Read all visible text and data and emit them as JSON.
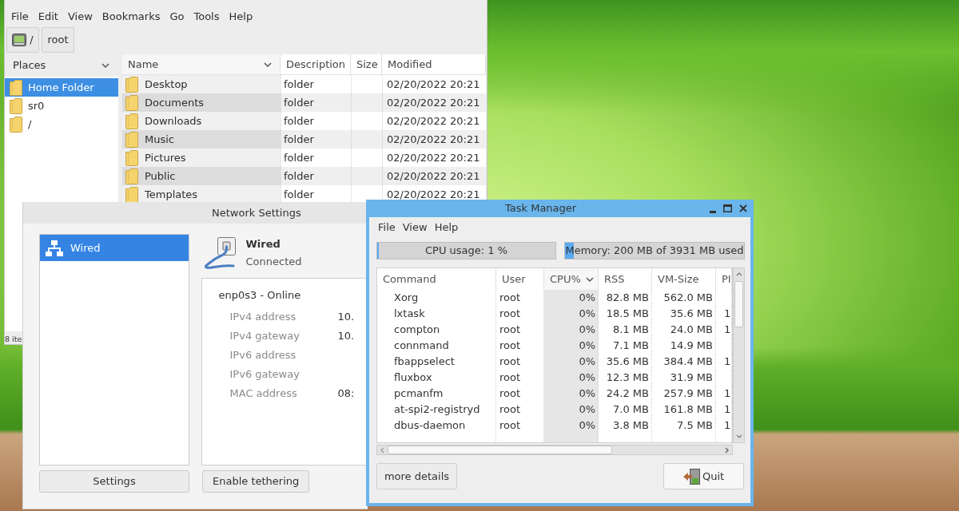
{
  "file_manager": {
    "menu": [
      "File",
      "Edit",
      "View",
      "Bookmarks",
      "Go",
      "Tools",
      "Help"
    ],
    "path_buttons": [
      {
        "label": "/",
        "kind": "drive"
      },
      {
        "label": "root",
        "kind": "plain"
      }
    ],
    "places": {
      "title": "Places",
      "items": [
        {
          "label": "Home Folder",
          "selected": true
        },
        {
          "label": "sr0",
          "selected": false
        },
        {
          "label": "/",
          "selected": false
        }
      ]
    },
    "columns": [
      {
        "label": "Name",
        "sorted": true
      },
      {
        "label": "Description",
        "sorted": false
      },
      {
        "label": "Size",
        "sorted": false
      },
      {
        "label": "Modified",
        "sorted": false
      }
    ],
    "rows": [
      {
        "name": "Desktop",
        "description": "folder",
        "modified": "02/20/2022 20:21"
      },
      {
        "name": "Documents",
        "description": "folder",
        "modified": "02/20/2022 20:21"
      },
      {
        "name": "Downloads",
        "description": "folder",
        "modified": "02/20/2022 20:21"
      },
      {
        "name": "Music",
        "description": "folder",
        "modified": "02/20/2022 20:21"
      },
      {
        "name": "Pictures",
        "description": "folder",
        "modified": "02/20/2022 20:21"
      },
      {
        "name": "Public",
        "description": "folder",
        "modified": "02/20/2022 20:21"
      },
      {
        "name": "Templates",
        "description": "folder",
        "modified": "02/20/2022 20:21"
      }
    ],
    "status_bar": "8 ite"
  },
  "network_settings": {
    "title": "Network Settings",
    "connections": [
      {
        "label": "Wired",
        "selected": true
      }
    ],
    "connection": {
      "name": "Wired",
      "status": "Connected"
    },
    "device": "enp0s3 - Online",
    "details": [
      {
        "label": "IPv4 address",
        "value": "10."
      },
      {
        "label": "IPv4 gateway",
        "value": "10."
      },
      {
        "label": "IPv6 address"
      },
      {
        "label": "IPv6 gateway"
      },
      {
        "label": "MAC address",
        "value": "08:"
      }
    ],
    "buttons": [
      "Settings",
      "Enable tethering"
    ]
  },
  "task_manager": {
    "title": "Task Manager",
    "menu": [
      "File",
      "View",
      "Help"
    ],
    "cpu": {
      "label": "CPU usage: 1 %",
      "level": 0.01
    },
    "memory": {
      "label": "Memory: 200 MB of 3931 MB used",
      "level": 0.05
    },
    "columns": [
      {
        "label": "Command",
        "sorted": false
      },
      {
        "label": "User",
        "sorted": false
      },
      {
        "label": "CPU%",
        "sorted": true
      },
      {
        "label": "RSS",
        "sorted": false
      },
      {
        "label": "VM-Size",
        "sorted": false
      },
      {
        "label": "PI",
        "sorted": false
      }
    ],
    "rows": [
      {
        "command": "Xorg",
        "user": "root",
        "cpu": "0%",
        "rss": "82.8 MB",
        "vm_size": "562.0 MB"
      },
      {
        "command": "lxtask",
        "user": "root",
        "cpu": "0%",
        "rss": "18.5 MB",
        "vm_size": "35.6 MB",
        "column_6": "1"
      },
      {
        "command": "compton",
        "user": "root",
        "cpu": "0%",
        "rss": "8.1 MB",
        "vm_size": "24.0 MB",
        "column_6": "1"
      },
      {
        "command": "connmand",
        "user": "root",
        "cpu": "0%",
        "rss": "7.1 MB",
        "vm_size": "14.9 MB"
      },
      {
        "command": "fbappselect",
        "user": "root",
        "cpu": "0%",
        "rss": "35.6 MB",
        "vm_size": "384.4 MB",
        "column_6": "1"
      },
      {
        "command": "fluxbox",
        "user": "root",
        "cpu": "0%",
        "rss": "12.3 MB",
        "vm_size": "31.9 MB"
      },
      {
        "command": "pcmanfm",
        "user": "root",
        "cpu": "0%",
        "rss": "24.2 MB",
        "vm_size": "257.9 MB",
        "column_6": "1"
      },
      {
        "command": "at-spi2-registryd",
        "user": "root",
        "cpu": "0%",
        "rss": "7.0 MB",
        "vm_size": "161.8 MB",
        "column_6": "1"
      },
      {
        "command": "dbus-daemon",
        "user": "root",
        "cpu": "0%",
        "rss": "3.8 MB",
        "vm_size": "7.5 MB",
        "column_6": "1"
      }
    ],
    "buttons": [
      "more details",
      "Quit"
    ]
  }
}
